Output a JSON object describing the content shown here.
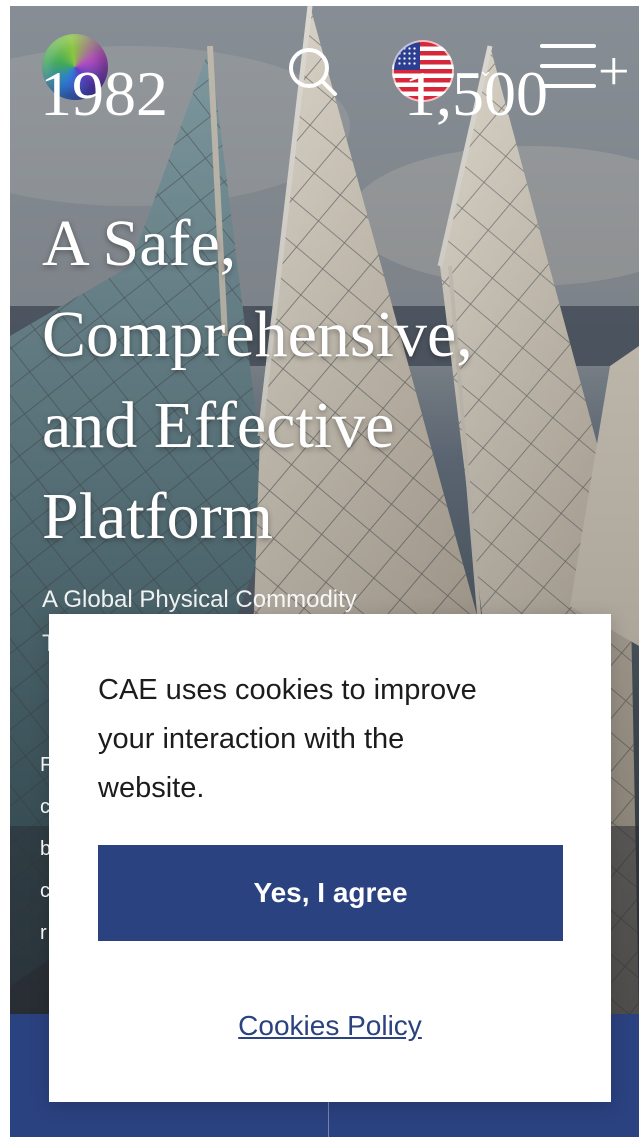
{
  "header": {
    "logo_icon": "globe-logo-icon",
    "search_icon": "search-icon",
    "language_icon": "us-flag-icon",
    "language_chevron": "⌄",
    "menu_icon": "hamburger-menu-icon"
  },
  "hero": {
    "title_lines": [
      "A Safe,",
      "Comprehensive,",
      "and Effective",
      "Platform"
    ],
    "subtitle_lines": [
      "A Global Physical Commodity",
      "T"
    ],
    "peek_letters": [
      "F",
      "c",
      "b",
      "c",
      "r"
    ]
  },
  "stats": {
    "items": [
      "1982",
      "1,500"
    ],
    "plus": "+"
  },
  "cookie_modal": {
    "message_lines": [
      "CAE uses cookies to improve",
      "your interaction with the",
      "website."
    ],
    "agree_label": "Yes, I agree",
    "policy_label": "Cookies Policy"
  },
  "colors": {
    "brand_navy": "#2b4280",
    "modal_bg": "#ffffff",
    "hero_text": "#ffffff"
  }
}
